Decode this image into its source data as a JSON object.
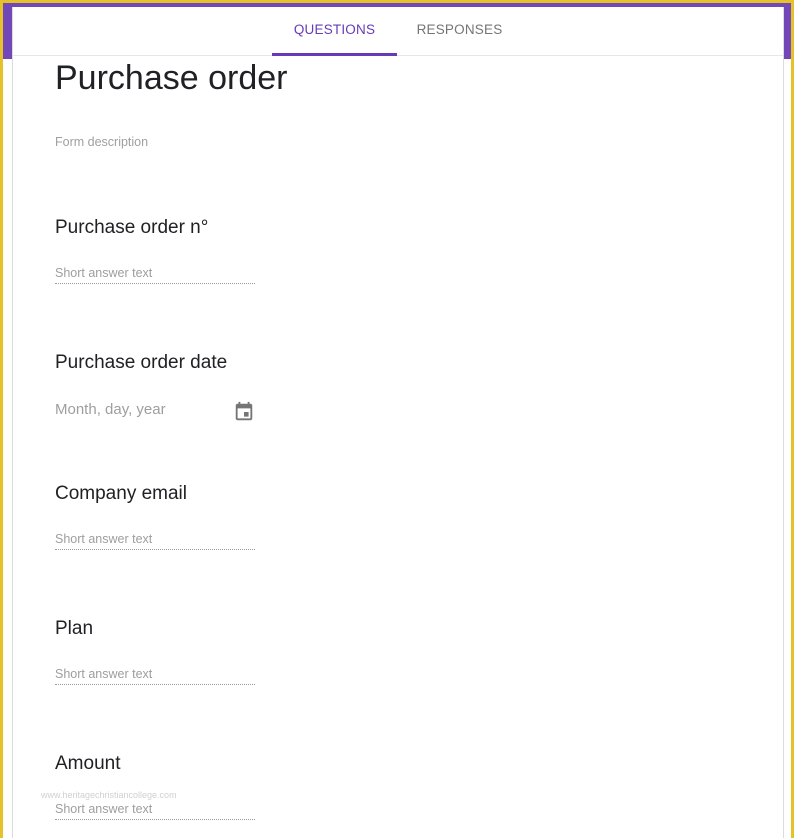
{
  "tabs": {
    "questions": "QUESTIONS",
    "responses": "RESPONSES"
  },
  "form": {
    "title": "Purchase order",
    "description": "Form description"
  },
  "questions": [
    {
      "title": "Purchase order n°",
      "placeholder": "Short answer text"
    },
    {
      "title": "Purchase order date",
      "placeholder": "Month, day, year",
      "icon": "calendar-icon"
    },
    {
      "title": "Company email",
      "placeholder": "Short answer text"
    },
    {
      "title": "Plan",
      "placeholder": "Short answer text"
    },
    {
      "title": "Amount",
      "placeholder": "Short answer text"
    }
  ],
  "watermark": "www.heritagechristiancollege.com",
  "colors": {
    "accent": "#673ab7",
    "header": "#7248b9",
    "border": "#e6c22a"
  }
}
